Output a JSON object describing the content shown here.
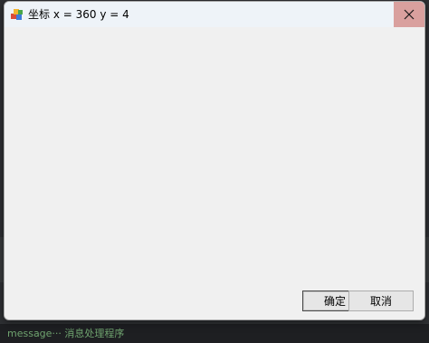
{
  "dialog": {
    "title": "坐标 x = 360 y = 4",
    "icon": "app-cubes-icon",
    "close_icon": "close-icon",
    "ok_label": "确定",
    "cancel_label": "取消"
  },
  "background": {
    "terminal_text": "message···  消息处理程序"
  },
  "colors": {
    "close_button": "#d9a09e",
    "titlebar": "#eef3f8",
    "dialog_body": "#f0f0f0"
  }
}
